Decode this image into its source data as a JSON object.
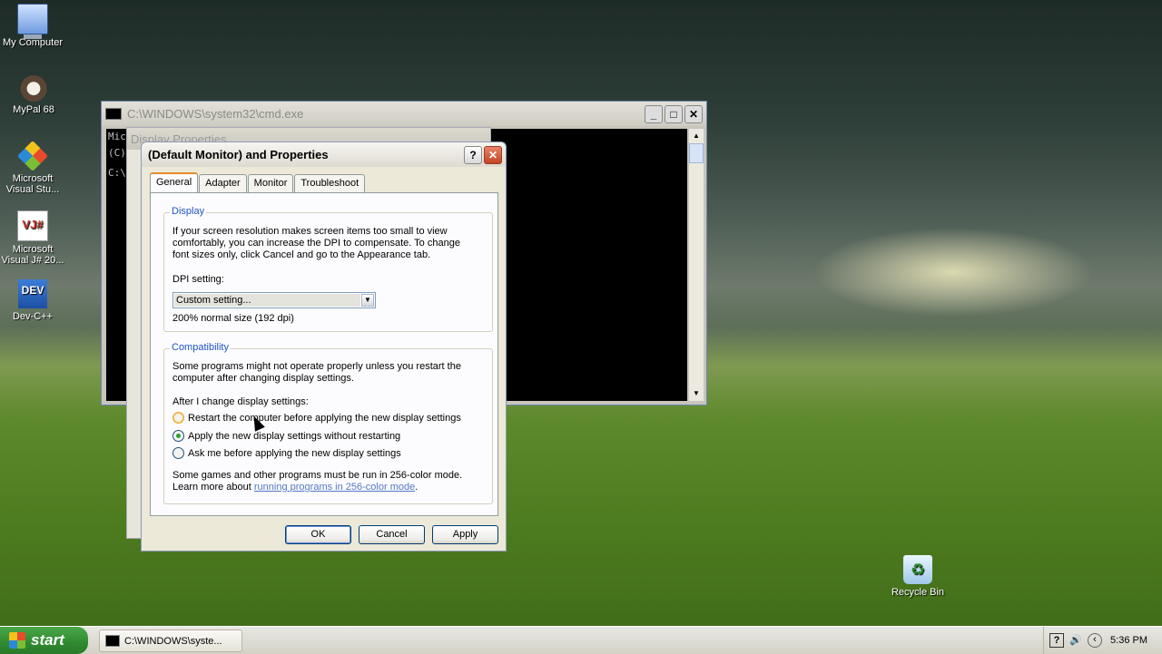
{
  "desktop": {
    "icons": [
      {
        "label": "My Computer",
        "icon": "computer-icon"
      },
      {
        "label": "MyPal 68",
        "icon": "mypal-icon"
      },
      {
        "label": "Microsoft Visual Stu...",
        "icon": "visual-studio-icon"
      },
      {
        "label": "Microsoft Visual J# 20...",
        "icon": "visual-jsharp-icon"
      },
      {
        "label": "Dev-C++",
        "icon": "devcpp-icon"
      },
      {
        "label": "Recycle Bin",
        "icon": "recycle-bin-icon"
      }
    ]
  },
  "cmd_window": {
    "title": "C:\\WINDOWS\\system32\\cmd.exe",
    "lines": [
      "Mic",
      "(C)",
      "",
      "C:\\"
    ]
  },
  "ghost_window": {
    "title": "Display Properties"
  },
  "dialog": {
    "title": "(Default Monitor) and  Properties",
    "tabs": [
      "General",
      "Adapter",
      "Monitor",
      "Troubleshoot"
    ],
    "active_tab": "General",
    "display_group": {
      "legend": "Display",
      "description": "If your screen resolution makes screen items too small to view comfortably, you can increase the DPI to compensate.  To change font sizes only, click Cancel and go to the Appearance tab.",
      "dpi_label": "DPI setting:",
      "dpi_value": "Custom setting...",
      "dpi_info": "200% normal size (192 dpi)"
    },
    "compat_group": {
      "legend": "Compatibility",
      "description": "Some programs might not operate properly unless you restart the computer after changing display settings.",
      "after_label": "After I change display settings:",
      "options": [
        "Restart the computer before applying the new display settings",
        "Apply the new display settings without restarting",
        "Ask me before applying the new display settings"
      ],
      "selected_index": 1,
      "footer_text": "Some games and other programs must be run in 256-color mode.",
      "learn_prefix": "Learn more about ",
      "learn_link": "running programs in 256-color mode",
      "learn_suffix": "."
    },
    "buttons": {
      "ok": "OK",
      "cancel": "Cancel",
      "apply": "Apply"
    }
  },
  "taskbar": {
    "start_label": "start",
    "task_label": "C:\\WINDOWS\\syste...",
    "clock": "5:36 PM"
  }
}
